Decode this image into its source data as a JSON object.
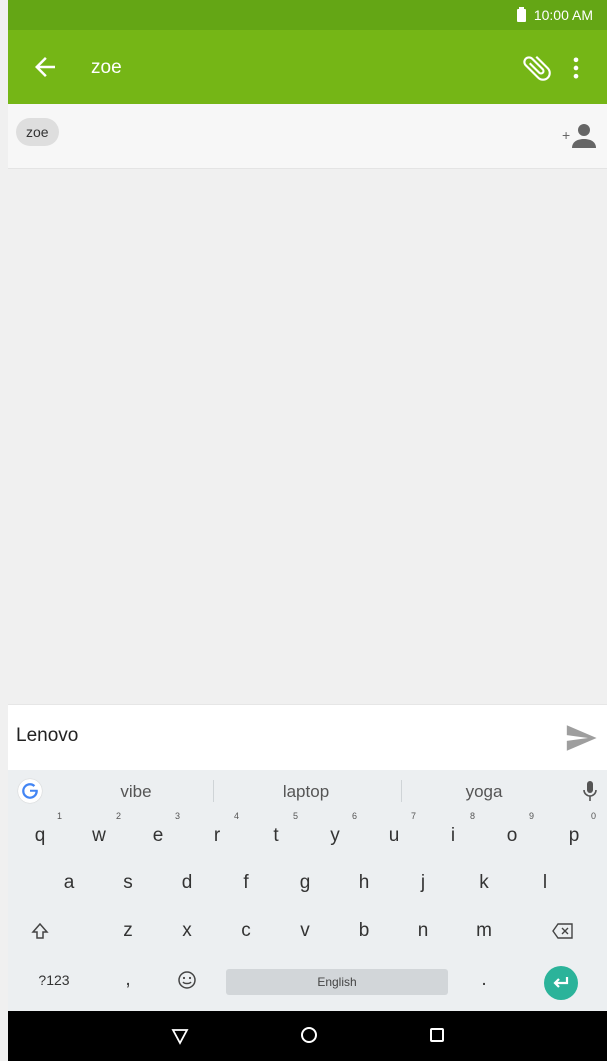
{
  "status_bar": {
    "time": "10:00 AM"
  },
  "app_bar": {
    "title": "zoe"
  },
  "recipients": {
    "chip_label": "zoe"
  },
  "compose": {
    "text": "Lenovo"
  },
  "keyboard": {
    "suggestions": [
      "vibe",
      "laptop",
      "yoga"
    ],
    "row1": [
      {
        "key": "q",
        "hint": "1"
      },
      {
        "key": "w",
        "hint": "2"
      },
      {
        "key": "e",
        "hint": "3"
      },
      {
        "key": "r",
        "hint": "4"
      },
      {
        "key": "t",
        "hint": "5"
      },
      {
        "key": "y",
        "hint": "6"
      },
      {
        "key": "u",
        "hint": "7"
      },
      {
        "key": "i",
        "hint": "8"
      },
      {
        "key": "o",
        "hint": "9"
      },
      {
        "key": "p",
        "hint": "0"
      }
    ],
    "row2": [
      "a",
      "s",
      "d",
      "f",
      "g",
      "h",
      "j",
      "k",
      "l"
    ],
    "row3": [
      "z",
      "x",
      "c",
      "v",
      "b",
      "n",
      "m"
    ],
    "symbols_label": "?123",
    "comma": ",",
    "period": ".",
    "space_label": "English"
  },
  "colors": {
    "status_bar": "#64a615",
    "app_bar": "#75b616",
    "enter_key": "#2bb39a"
  }
}
